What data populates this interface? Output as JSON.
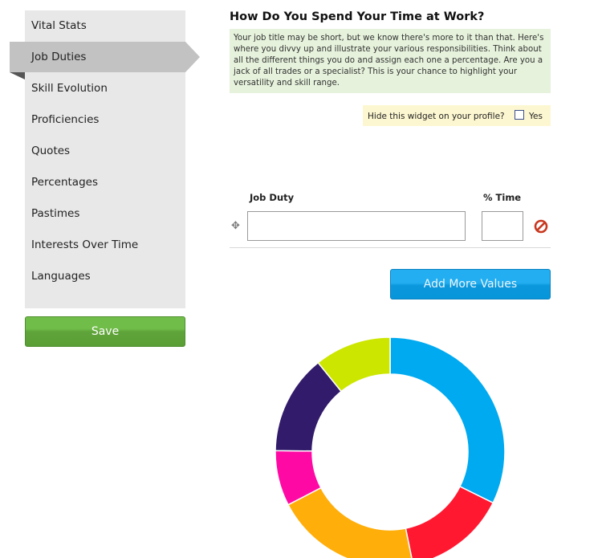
{
  "sidebar": {
    "items": [
      {
        "label": "Vital Stats"
      },
      {
        "label": "Job Duties",
        "active": true
      },
      {
        "label": "Skill Evolution"
      },
      {
        "label": "Proficiencies"
      },
      {
        "label": "Quotes"
      },
      {
        "label": "Percentages"
      },
      {
        "label": "Pastimes"
      },
      {
        "label": "Interests Over Time"
      },
      {
        "label": "Languages"
      }
    ],
    "save_label": "Save"
  },
  "main": {
    "title": "How Do You Spend Your Time at Work?",
    "description": "Your job title may be short, but we know there's more to it than that. Here's where you divvy up and illustrate your various responsibilities. Think about all the different things you do and assign each one a percentage. Are you a jack of all trades or a specialist? This is your chance to highlight your versatility and skill range.",
    "hide_widget": {
      "label": "Hide this widget on your profile?",
      "option": "Yes",
      "checked": false
    },
    "table": {
      "headers": {
        "duty": "Job Duty",
        "time": "% Time"
      },
      "rows": [
        {
          "duty": "",
          "time": ""
        }
      ]
    },
    "add_more_label": "Add More Values"
  },
  "icons": {
    "drag": "move-icon",
    "remove": "remove-icon"
  },
  "colors": {
    "save": "#64ad3f",
    "add_more": "#0ea0e6",
    "description_bg": "#e6f2dc",
    "hide_widget_bg": "#fdf7d1",
    "remove_icon": "#c9381f"
  },
  "chart_data": {
    "type": "pie",
    "donut": true,
    "slices": [
      {
        "color": "#00aaf0",
        "value": 32.3
      },
      {
        "color": "#ff1830",
        "value": 14.5
      },
      {
        "color": "#ffae0a",
        "value": 20.6
      },
      {
        "color": "#ff09a4",
        "value": 7.8
      },
      {
        "color": "#311b6a",
        "value": 14.0
      },
      {
        "color": "#cce600",
        "value": 10.8
      }
    ]
  }
}
